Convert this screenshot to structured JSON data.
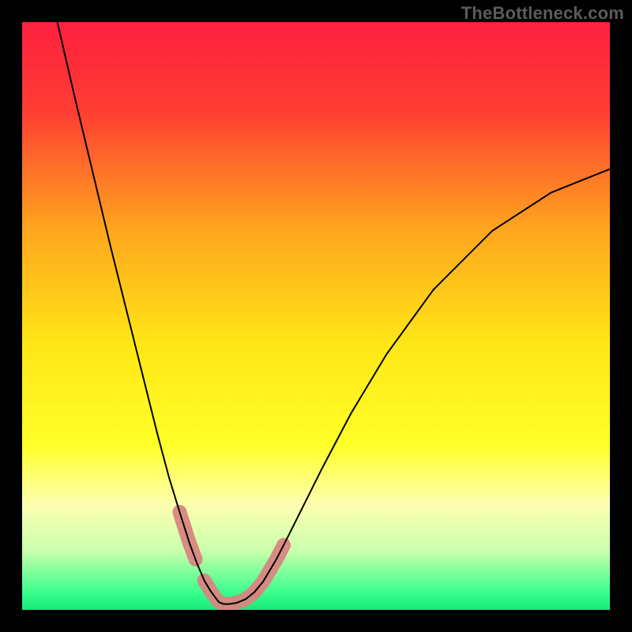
{
  "watermark": {
    "text": "TheBottleneck.com"
  },
  "chart_data": {
    "type": "line",
    "title": "",
    "xlabel": "",
    "ylabel": "",
    "xlim": [
      0,
      1
    ],
    "ylim": [
      0,
      1
    ],
    "grid": false,
    "legend": false,
    "background_gradient": {
      "direction": "vertical",
      "stops": [
        {
          "pos": 0.0,
          "color": "#fe203f"
        },
        {
          "pos": 0.15,
          "color": "#ff3d33"
        },
        {
          "pos": 0.35,
          "color": "#ffa41e"
        },
        {
          "pos": 0.55,
          "color": "#ffe716"
        },
        {
          "pos": 0.72,
          "color": "#ffff29"
        },
        {
          "pos": 0.82,
          "color": "#fdffb0"
        },
        {
          "pos": 0.9,
          "color": "#c9ffad"
        },
        {
          "pos": 0.97,
          "color": "#39ff8d"
        },
        {
          "pos": 1.0,
          "color": "#18e879"
        }
      ]
    },
    "series": [
      {
        "name": "bottleneck_curve",
        "color": "#000000",
        "stroke_width": 2,
        "x": [
          0.06,
          0.09,
          0.12,
          0.15,
          0.18,
          0.21,
          0.23,
          0.25,
          0.27,
          0.285,
          0.298,
          0.31,
          0.32,
          0.328,
          0.335,
          0.343,
          0.352,
          0.365,
          0.38,
          0.395,
          0.41,
          0.42,
          0.432,
          0.45,
          0.475,
          0.51,
          0.56,
          0.62,
          0.7,
          0.8,
          0.9,
          1.0
        ],
        "y": [
          1.0,
          0.87,
          0.745,
          0.62,
          0.5,
          0.38,
          0.3,
          0.225,
          0.16,
          0.113,
          0.078,
          0.05,
          0.033,
          0.022,
          0.013,
          0.01,
          0.01,
          0.012,
          0.018,
          0.03,
          0.048,
          0.065,
          0.085,
          0.12,
          0.17,
          0.24,
          0.335,
          0.435,
          0.545,
          0.645,
          0.71,
          0.75
        ]
      }
    ],
    "marker_overlays": [
      {
        "name": "pink_band_left",
        "color": "#d88681",
        "kind": "segment",
        "x_range": [
          0.268,
          0.295
        ],
        "y_range": [
          0.08,
          0.165
        ]
      },
      {
        "name": "pink_band_bottom",
        "color": "#d88681",
        "kind": "segment",
        "x_range": [
          0.31,
          0.395
        ],
        "y_range": [
          0.01,
          0.035
        ]
      },
      {
        "name": "pink_band_right",
        "color": "#d88681",
        "kind": "segment",
        "x_range": [
          0.398,
          0.445
        ],
        "y_range": [
          0.035,
          0.11
        ]
      }
    ]
  }
}
